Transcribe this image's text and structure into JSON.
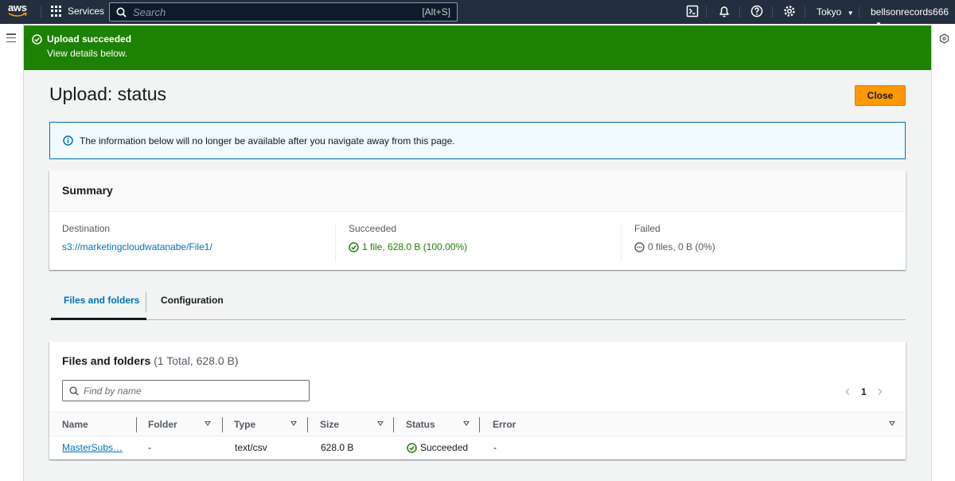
{
  "nav": {
    "logo": "aws",
    "services": "Services",
    "search_placeholder": "Search",
    "search_shortcut": "[Alt+S]",
    "region": "Tokyo",
    "account": "bellsonrecords666"
  },
  "flash": {
    "title": "Upload succeeded",
    "subtitle": "View details below.",
    "color": "#1d8102"
  },
  "page": {
    "title": "Upload: status",
    "close_label": "Close"
  },
  "info": {
    "text": "The information below will no longer be available after you navigate away from this page."
  },
  "summary": {
    "title": "Summary",
    "destination_label": "Destination",
    "destination_value": "s3://marketingcloudwatanabe/File1/",
    "succeeded_label": "Succeeded",
    "succeeded_value": "1 file, 628.0 B (100.00%)",
    "failed_label": "Failed",
    "failed_value": "0 files, 0 B (0%)"
  },
  "tabs": [
    {
      "label": "Files and folders",
      "active": true
    },
    {
      "label": "Configuration",
      "active": false
    }
  ],
  "files": {
    "title": "Files and folders",
    "count": "(1 Total, 628.0 B)",
    "filter_placeholder": "Find by name",
    "page": "1",
    "columns": [
      "Name",
      "Folder",
      "Type",
      "Size",
      "Status",
      "Error"
    ],
    "rows": [
      {
        "name": "MasterSubs…",
        "folder": "-",
        "type": "text/csv",
        "size": "628.0 B",
        "status": "Succeeded",
        "error": "-"
      }
    ]
  }
}
